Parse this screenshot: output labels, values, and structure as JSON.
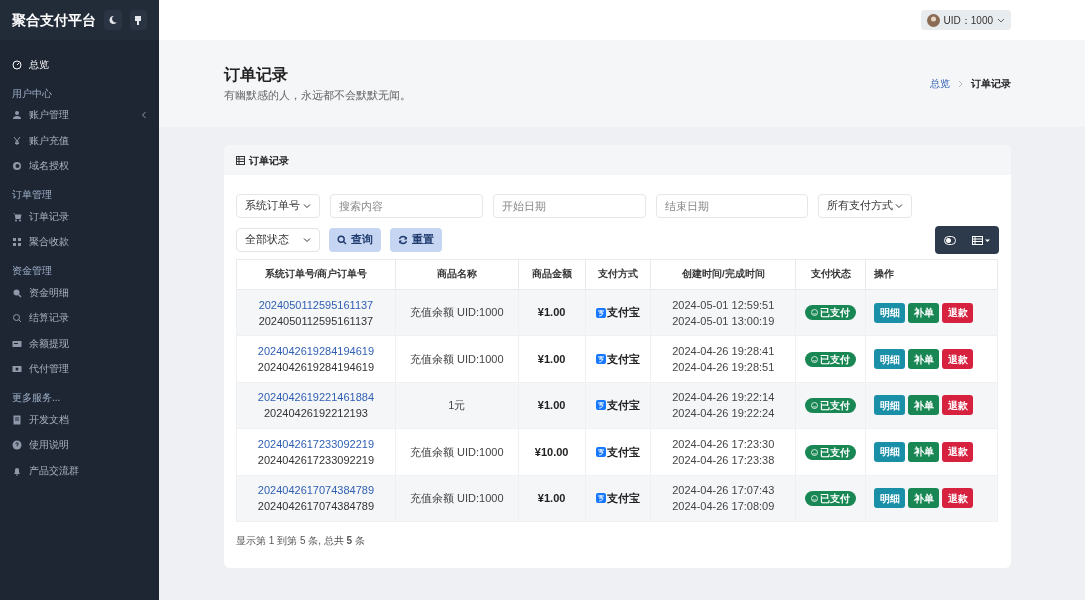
{
  "sidebar": {
    "brand": "聚合支付平台",
    "sections": [
      {
        "items": [
          {
            "label": "总览",
            "selected": true,
            "has_submenu": false
          }
        ]
      },
      {
        "title": "用户中心",
        "items": [
          {
            "label": "账户管理",
            "selected": false,
            "has_submenu": true
          },
          {
            "label": "账户充值",
            "selected": false,
            "has_submenu": false
          },
          {
            "label": "域名授权",
            "selected": false,
            "has_submenu": false
          }
        ]
      },
      {
        "title": "订单管理",
        "items": [
          {
            "label": "订单记录",
            "selected": false,
            "has_submenu": false
          },
          {
            "label": "聚合收款",
            "selected": false,
            "has_submenu": false
          }
        ]
      },
      {
        "title": "资金管理",
        "items": [
          {
            "label": "资金明细",
            "selected": false,
            "has_submenu": false
          },
          {
            "label": "结算记录",
            "selected": false,
            "has_submenu": false
          },
          {
            "label": "余额提现",
            "selected": false,
            "has_submenu": false
          },
          {
            "label": "代付管理",
            "selected": false,
            "has_submenu": false
          }
        ]
      },
      {
        "title": "更多服务...",
        "items": [
          {
            "label": "开发文档",
            "selected": false,
            "has_submenu": false
          },
          {
            "label": "使用说明",
            "selected": false,
            "has_submenu": false
          },
          {
            "label": "产品交流群",
            "selected": false,
            "has_submenu": false
          }
        ]
      }
    ]
  },
  "topbar": {
    "user": "UID：1000"
  },
  "page_header": {
    "title": "订单记录",
    "subtitle": "有幽默感的人，永远都不会默默无闻。",
    "breadcrumb": [
      {
        "label": "总览",
        "selected": false
      },
      {
        "label": "订单记录",
        "selected": true
      }
    ]
  },
  "card": {
    "title": "订单记录",
    "filters": [
      {
        "kind": "select",
        "value": "系统订单号"
      },
      {
        "kind": "input",
        "placeholder": "搜索内容"
      },
      {
        "kind": "input",
        "placeholder": "开始日期"
      },
      {
        "kind": "input",
        "placeholder": "结束日期"
      },
      {
        "kind": "select",
        "value": "所有支付方式"
      }
    ],
    "status_filter": "全部状态",
    "buttons": [
      "查询",
      "重置"
    ],
    "table": {
      "columns": [
        "系统订单号/商户订单号",
        "商品名称",
        "商品金额",
        "支付方式",
        "创建时间/完成时间",
        "支付状态",
        "操作"
      ],
      "rows": [
        {
          "trade_no": "2024050112595161137",
          "out_trade_no": "2024050112595161137",
          "name": "充值余额 UID:1000",
          "money": "¥1.00",
          "pay_type": "支付宝",
          "created": "2024-05-01 12:59:51",
          "finished": "2024-05-01 13:00:19",
          "status": "已支付",
          "actions": [
            "明细",
            "补单",
            "退款"
          ]
        },
        {
          "trade_no": "2024042619284194619",
          "out_trade_no": "2024042619284194619",
          "name": "充值余额 UID:1000",
          "money": "¥1.00",
          "pay_type": "支付宝",
          "created": "2024-04-26 19:28:41",
          "finished": "2024-04-26 19:28:51",
          "status": "已支付",
          "actions": [
            "明细",
            "补单",
            "退款"
          ]
        },
        {
          "trade_no": "2024042619221461884",
          "out_trade_no": "20240426192212193",
          "name": "1元",
          "money": "¥1.00",
          "pay_type": "支付宝",
          "created": "2024-04-26 19:22:14",
          "finished": "2024-04-26 19:22:24",
          "status": "已支付",
          "actions": [
            "明细",
            "补单",
            "退款"
          ]
        },
        {
          "trade_no": "2024042617233092219",
          "out_trade_no": "2024042617233092219",
          "name": "充值余额 UID:1000",
          "money": "¥10.00",
          "pay_type": "支付宝",
          "created": "2024-04-26 17:23:30",
          "finished": "2024-04-26 17:23:38",
          "status": "已支付",
          "actions": [
            "明细",
            "补单",
            "退款"
          ]
        },
        {
          "trade_no": "2024042617074384789",
          "out_trade_no": "2024042617074384789",
          "name": "充值余额 UID:1000",
          "money": "¥1.00",
          "pay_type": "支付宝",
          "created": "2024-04-26 17:07:43",
          "finished": "2024-04-26 17:08:09",
          "status": "已支付",
          "actions": [
            "明细",
            "补单",
            "退款"
          ]
        }
      ]
    },
    "pagination": "显示第 1 到第 5 条, 总共 **5** 条"
  }
}
